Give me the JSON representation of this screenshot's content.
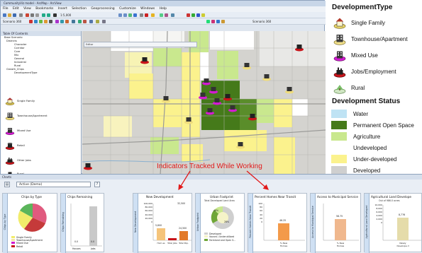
{
  "app": {
    "title": "CommunityViz model - ArcMap - ArcView",
    "menus": [
      "File",
      "Edit",
      "View",
      "Bookmarks",
      "Insert",
      "Selection",
      "Geoprocessing",
      "Customize",
      "Windows",
      "Help"
    ],
    "scale": "1:5,000",
    "scenario_label": "Scenario 360",
    "scenario_label_2": "Scenario 360"
  },
  "toc": {
    "title": "Table Of Contents",
    "tree": [
      "Base Scenario",
      "Districts",
      "Character",
      "Corridor",
      "Core",
      "Mix",
      "General",
      "Industrial",
      "Rural",
      "Growth_Chips",
      "DevelopmentType"
    ],
    "legend_items": [
      "Single Family",
      "Townhouse/Apartment",
      "Mixed Use",
      "Retail",
      "Other Jobs",
      "Rural"
    ]
  },
  "map": {
    "toolbar_label": "Editor"
  },
  "annotation": "Indicators Tracked While Working",
  "legend": {
    "dev_type_title": "DevelopmentType",
    "dev_types": [
      {
        "label": "Single Family",
        "icon": "house-chip-icon",
        "color": "#e9d66b"
      },
      {
        "label": "Townhouse/Apartment",
        "icon": "apartment-chip-icon",
        "color": "#f3e28e"
      },
      {
        "label": "Mixed Use",
        "icon": "mixed-use-chip-icon",
        "color": "#d21bd0"
      },
      {
        "label": "Jobs/Employment",
        "icon": "jobs-chip-icon",
        "color": "#c8141a"
      },
      {
        "label": "Rural",
        "icon": "rural-chip-icon",
        "color": "#7bbf6a"
      }
    ],
    "status_title": "Development Status",
    "statuses": [
      {
        "label": "Water",
        "color": "#bfe3f4"
      },
      {
        "label": "Permanent Open Space",
        "color": "#457a1a"
      },
      {
        "label": "Agriculture",
        "color": "#c9e88e"
      },
      {
        "label": "Undeveloped",
        "color": "#ffffff"
      },
      {
        "label": "Under-developed",
        "color": "#fbf28d"
      },
      {
        "label": "Developed",
        "color": "#cfcfcf"
      }
    ]
  },
  "charts_panel": {
    "title": "Charts",
    "active_selector": "Active (Demo)",
    "help_glyph": "?",
    "cards": [
      {
        "tab": "Chips by Type",
        "title": "Chips by Type",
        "legend": [
          "Single Family",
          "Townhouse/Apartment",
          "Mixed Use",
          "Retail"
        ]
      },
      {
        "tab": "Chips Remaining",
        "title": "Chips Remaining",
        "values": [
          "0.0",
          "0.0"
        ],
        "labels": [
          "Houses",
          "Jobs"
        ]
      },
      {
        "tab": "New Development",
        "title": "New Development",
        "values": [
          "32,500",
          "5,600",
          "24,500"
        ],
        "yticks": [
          "100,000",
          "80,000",
          "60,000",
          "40,000",
          "20,000",
          "0"
        ],
        "labels": [
          "Hom es",
          "Total Jobs",
          "Total Pop."
        ]
      },
      {
        "tab": "Urban Footprint",
        "title": "Urban Footprint",
        "subtitle": "Total Developed Land Area",
        "slices": [
          "46%",
          "28%"
        ],
        "legend": [
          "Developed",
          "Vacant / Underutilized",
          "Farmland and Open S..."
        ]
      },
      {
        "tab": "Percent Homes Near Transit",
        "title": "Percent Homes Near Transit",
        "value": "46.25",
        "yticks": [
          "100",
          "80",
          "60",
          "40",
          "20",
          "0"
        ],
        "label": "% New Homes"
      },
      {
        "tab": "Access to Municipal Service",
        "title": "Access to Municipal Service",
        "value": "58.75",
        "label": "% New Homes"
      },
      {
        "tab": "Agricultural Land Developed",
        "title": "Agricultural Land Develope",
        "subtitle": "Out of 986.0 acres",
        "value": "8,776",
        "yticks": [
          "10,000",
          "8,000",
          "6,000",
          "4,000",
          "2,000",
          "0"
        ],
        "label": "Newly Develope d"
      }
    ]
  }
}
